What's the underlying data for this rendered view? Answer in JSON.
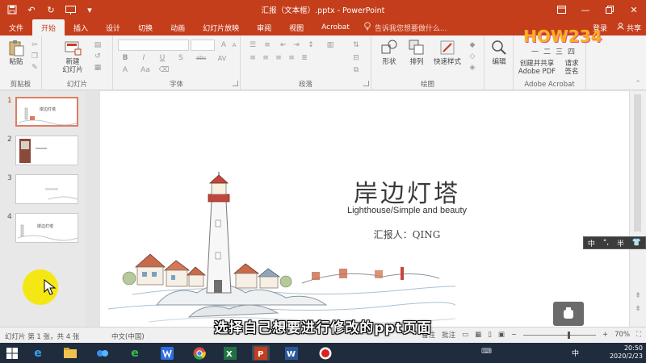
{
  "window": {
    "title": "汇报（文本框）.pptx - PowerPoint",
    "login": "登录",
    "share": "共享"
  },
  "tabs": [
    {
      "label": "文件"
    },
    {
      "label": "开始"
    },
    {
      "label": "插入"
    },
    {
      "label": "设计"
    },
    {
      "label": "切换"
    },
    {
      "label": "动画"
    },
    {
      "label": "幻灯片放映"
    },
    {
      "label": "审阅"
    },
    {
      "label": "视图"
    },
    {
      "label": "Acrobat"
    }
  ],
  "active_tab": "开始",
  "tell_me": "告诉我您想要做什么...",
  "ribbon": {
    "clipboard": {
      "paste": "粘贴",
      "group": "剪贴板"
    },
    "slides": {
      "new_slide_line1": "新建",
      "new_slide_line2": "幻灯片",
      "group": "幻灯片"
    },
    "font": {
      "group": "字体",
      "bold": "B",
      "italic": "I",
      "underline": "U",
      "strike": "S",
      "shadow": "abc",
      "spacing": "AV",
      "size_up": "A",
      "size_down": "A",
      "case": "Aa",
      "color": "A"
    },
    "paragraph": {
      "group": "段落"
    },
    "drawing": {
      "shapes": "形状",
      "arrange": "排列",
      "quick_styles": "快速样式",
      "group": "绘图"
    },
    "editing": {
      "label": "编辑"
    },
    "acrobat": {
      "create_share_line1": "创建并共享",
      "create_share_line2": "Adobe PDF",
      "request_line1": "请求",
      "request_line2": "签名",
      "group": "Adobe Acrobat"
    }
  },
  "thumbnails": [
    {
      "num": "1",
      "title": "岸边灯塔"
    },
    {
      "num": "2",
      "title": ""
    },
    {
      "num": "3",
      "title": ""
    },
    {
      "num": "4",
      "title": "岸边灯塔"
    }
  ],
  "slide": {
    "title": "岸边灯塔",
    "subtitle": "Lighthouse/Simple and beauty",
    "reporter": "汇报人：QING"
  },
  "status": {
    "slide_info": "幻灯片 第 1 张，共 4 张",
    "language": "中文(中国)",
    "notes": "备注",
    "comments": "批注",
    "zoom": "70%"
  },
  "ime": {
    "mode": "中",
    "punct": "°,",
    "width": "半"
  },
  "video_subtitle": "选择自己想要进行修改的ppt页面",
  "watermark": {
    "brand": "HOW234",
    "sub": "一二三四"
  },
  "taskbar": {
    "time": "20:50",
    "date": "2020/2/23",
    "ime": "中"
  },
  "colors": {
    "accent": "#c43e1c",
    "ribbon_bg": "#f3f3f3",
    "taskbar": "#1f2c3d"
  }
}
